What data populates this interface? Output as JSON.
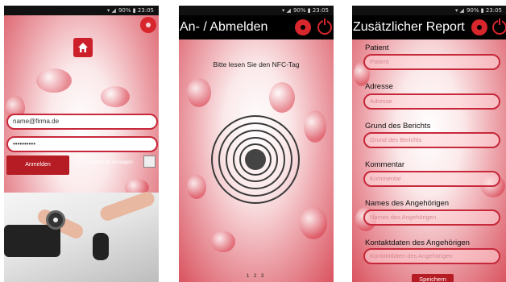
{
  "status_bar": {
    "time": "23:05",
    "battery": "90%"
  },
  "login_screen": {
    "email_value": "name@firma.de",
    "password_value": "••••••••••",
    "login_button": "Anmelden",
    "show_password_label": "Passwort anzeigen"
  },
  "nfc_screen": {
    "title": "An- / Abmelden",
    "instruction": "Bitte lesen Sie den NFC-Tag",
    "pager": "1 2 3"
  },
  "report_screen": {
    "title": "Zusätzlicher Report",
    "fields": [
      {
        "label": "Patient",
        "placeholder": "Patient"
      },
      {
        "label": "Adresse",
        "placeholder": "Adresse"
      },
      {
        "label": "Grund des Berichts",
        "placeholder": "Grund des Berichts"
      },
      {
        "label": "Kommentar",
        "placeholder": "Kommentar"
      },
      {
        "label": "Names des Angehörigen",
        "placeholder": "Names des Angehörigen"
      },
      {
        "label": "Kontaktdaten des Angehörigen",
        "placeholder": "Kontaktdaten des Angehörigen"
      }
    ],
    "save_button": "Speichern"
  },
  "colors": {
    "accent": "#d7262c",
    "button": "#b51c24",
    "field_border": "#c7283a",
    "appbar": "#000000"
  },
  "icons": [
    "gear-icon",
    "power-icon",
    "home-icon",
    "checkbox",
    "nfc-rings-icon"
  ]
}
